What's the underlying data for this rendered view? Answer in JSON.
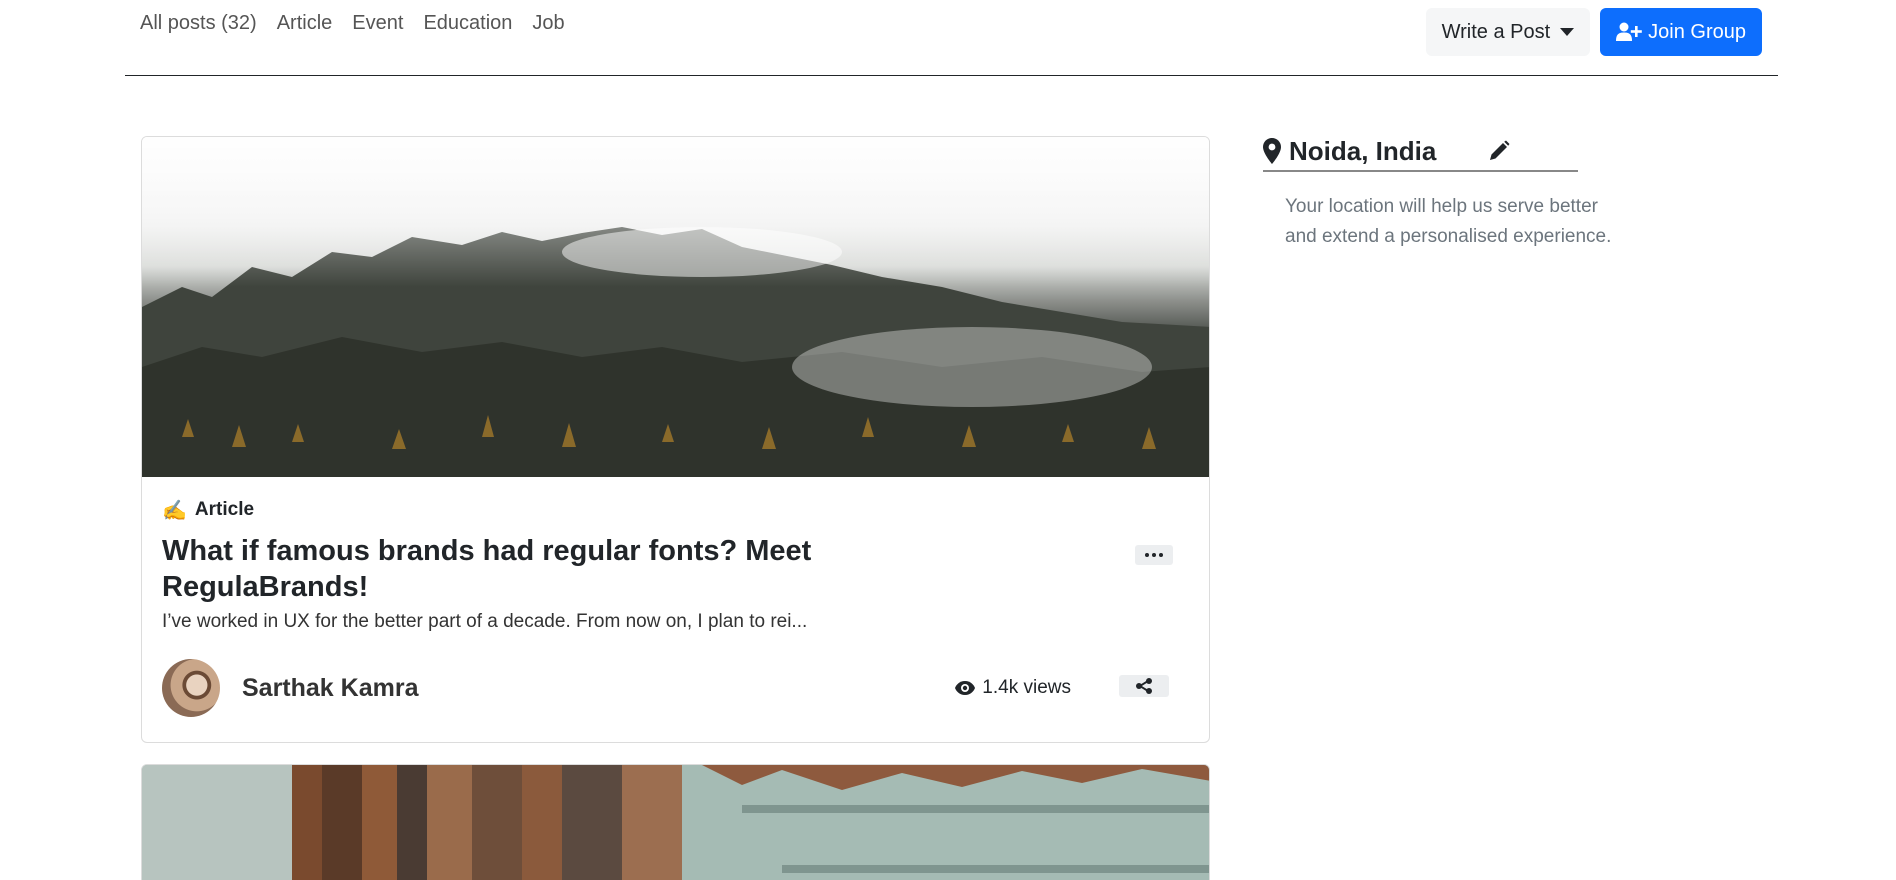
{
  "nav": {
    "tabs": [
      {
        "label": "All posts (32)"
      },
      {
        "label": "Article"
      },
      {
        "label": "Event"
      },
      {
        "label": "Education"
      },
      {
        "label": "Job"
      }
    ]
  },
  "actions": {
    "write_label": "Write a Post",
    "join_label": "Join Group"
  },
  "posts": [
    {
      "tag_emoji": "✍️",
      "tag": "Article",
      "title": "What if famous brands had regular fonts? Meet RegulaBrands!",
      "excerpt": "I’ve worked in UX for the better part of a decade. From now on, I plan to rei...",
      "author": "Sarthak Kamra",
      "views": "1.4k views"
    }
  ],
  "sidebar": {
    "location": "Noida, India",
    "description": "Your location will help us serve better and extend a personalised experience."
  },
  "colors": {
    "accent": "#0d6efd",
    "text": "#212529",
    "muted": "#6c757d"
  }
}
